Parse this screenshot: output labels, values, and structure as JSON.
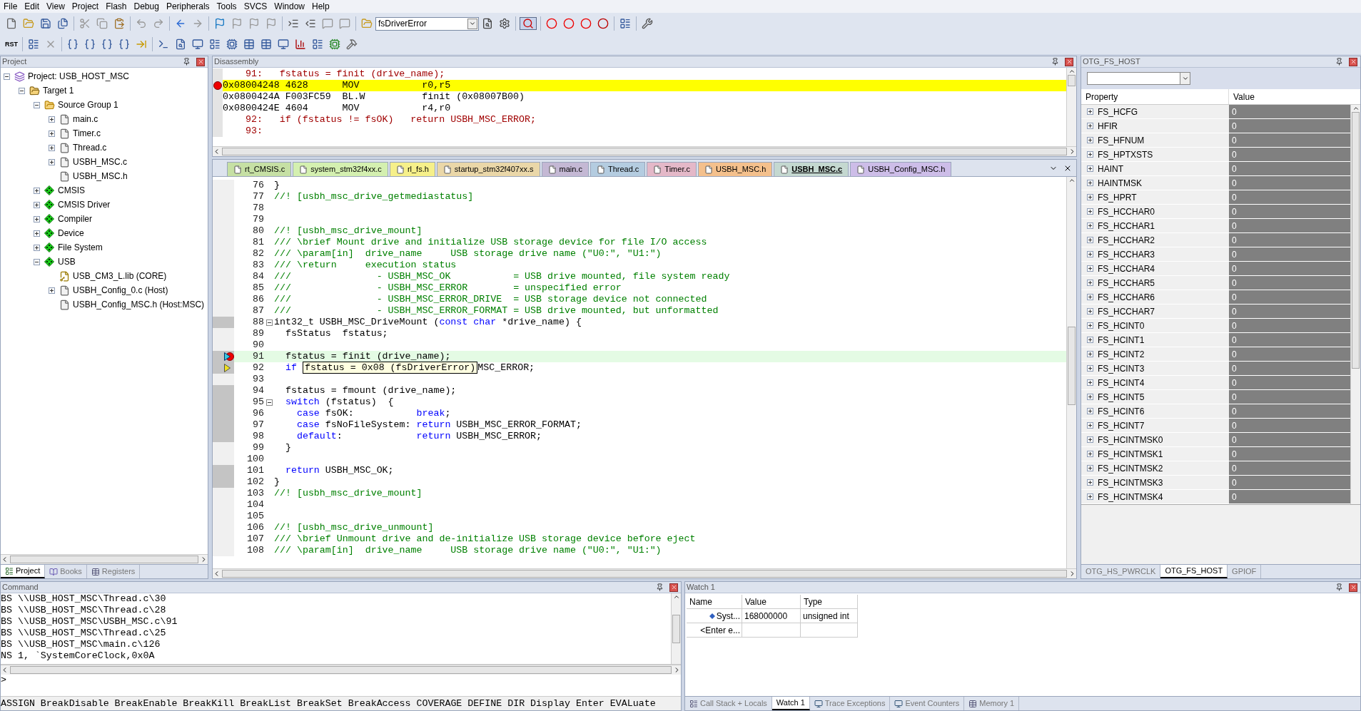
{
  "menu": [
    "File",
    "Edit",
    "View",
    "Project",
    "Flash",
    "Debug",
    "Peripherals",
    "Tools",
    "SVCS",
    "Window",
    "Help"
  ],
  "toolbar": {
    "find_value": "fsDriverError",
    "reset_label": "RST"
  },
  "project_panel": {
    "title": "Project",
    "tree": [
      {
        "label": "Project: USB_HOST_MSC",
        "kind": "project",
        "expanded": true,
        "children": [
          {
            "label": "Target 1",
            "kind": "target",
            "expanded": true,
            "children": [
              {
                "label": "Source Group 1",
                "kind": "folder",
                "expanded": true,
                "children": [
                  {
                    "label": "main.c",
                    "kind": "file",
                    "expanded": false
                  },
                  {
                    "label": "Timer.c",
                    "kind": "file",
                    "expanded": false
                  },
                  {
                    "label": "Thread.c",
                    "kind": "file",
                    "expanded": false
                  },
                  {
                    "label": "USBH_MSC.c",
                    "kind": "file",
                    "expanded": false
                  },
                  {
                    "label": "USBH_MSC.h",
                    "kind": "file"
                  }
                ]
              },
              {
                "label": "CMSIS",
                "kind": "component",
                "expanded": false
              },
              {
                "label": "CMSIS Driver",
                "kind": "component",
                "expanded": false
              },
              {
                "label": "Compiler",
                "kind": "component",
                "expanded": false
              },
              {
                "label": "Device",
                "kind": "component",
                "expanded": false
              },
              {
                "label": "File System",
                "kind": "component",
                "expanded": false
              },
              {
                "label": "USB",
                "kind": "component",
                "expanded": true,
                "children": [
                  {
                    "label": "USB_CM3_L.lib (CORE)",
                    "kind": "library"
                  },
                  {
                    "label": "USBH_Config_0.c (Host)",
                    "kind": "file",
                    "expanded": false
                  },
                  {
                    "label": "USBH_Config_MSC.h (Host:MSC)",
                    "kind": "file"
                  }
                ]
              }
            ]
          }
        ]
      }
    ],
    "tabs": [
      {
        "label": "Project",
        "selected": true
      },
      {
        "label": "Books",
        "selected": false
      },
      {
        "label": "Registers",
        "selected": false
      }
    ]
  },
  "disassembly": {
    "title": "Disassembly",
    "lines": [
      {
        "kind": "source",
        "text": "    91:   fstatus = finit (drive_name);",
        "current": false,
        "breakpoint": false
      },
      {
        "kind": "asm",
        "text": "0x08004248 4628      MOV           r0,r5",
        "current": true,
        "breakpoint": true
      },
      {
        "kind": "asm",
        "text": "0x0800424A F003FC59  BL.W          finit (0x08007B00)",
        "current": false,
        "breakpoint": false
      },
      {
        "kind": "asm",
        "text": "0x0800424E 4604      MOV           r4,r0",
        "current": false,
        "breakpoint": false
      },
      {
        "kind": "source",
        "text": "    92:   if (fstatus != fsOK)   return USBH_MSC_ERROR;",
        "current": false,
        "breakpoint": false
      },
      {
        "kind": "source",
        "text": "    93: ",
        "current": false,
        "breakpoint": false
      }
    ]
  },
  "file_tabs": [
    {
      "label": "rt_CMSIS.c",
      "color": "#c6e0a4",
      "selected": false
    },
    {
      "label": "system_stm32f4xx.c",
      "color": "#d4f0b0",
      "selected": false
    },
    {
      "label": "rl_fs.h",
      "color": "#f6f08a",
      "selected": false
    },
    {
      "label": "startup_stm32f407xx.s",
      "color": "#ead7a8",
      "selected": false
    },
    {
      "label": "main.c",
      "color": "#c4b8d4",
      "selected": false
    },
    {
      "label": "Thread.c",
      "color": "#b4cce0",
      "selected": false
    },
    {
      "label": "Timer.c",
      "color": "#e4b8c8",
      "selected": false
    },
    {
      "label": "USBH_MSC.h",
      "color": "#f4c08c",
      "selected": false
    },
    {
      "label": "USBH_MSC.c",
      "color": "#c4d8d0",
      "selected": true
    },
    {
      "label": "USBH_Config_MSC.h",
      "color": "#cdbde8",
      "selected": false
    }
  ],
  "editor": {
    "lines": [
      {
        "number": "76",
        "exec": false,
        "current": false,
        "foldable": false,
        "breakpoint": false,
        "pc": false,
        "caller": false,
        "segments": [
          {
            "kind": "plain",
            "text": "}"
          }
        ]
      },
      {
        "number": "77",
        "exec": false,
        "current": false,
        "foldable": false,
        "breakpoint": false,
        "pc": false,
        "caller": false,
        "segments": [
          {
            "kind": "comment",
            "text": "//! [usbh_msc_drive_getmediastatus]"
          }
        ]
      },
      {
        "number": "78",
        "exec": false,
        "current": false,
        "foldable": false,
        "breakpoint": false,
        "pc": false,
        "caller": false
      },
      {
        "number": "79",
        "exec": false,
        "current": false,
        "foldable": false,
        "breakpoint": false,
        "pc": false,
        "caller": false
      },
      {
        "number": "80",
        "exec": false,
        "current": false,
        "foldable": false,
        "breakpoint": false,
        "pc": false,
        "caller": false,
        "segments": [
          {
            "kind": "comment",
            "text": "//! [usbh_msc_drive_mount]"
          }
        ]
      },
      {
        "number": "81",
        "exec": false,
        "current": false,
        "foldable": false,
        "breakpoint": false,
        "pc": false,
        "caller": false,
        "segments": [
          {
            "kind": "comment",
            "text": "/// \\brief Mount drive and initialize USB storage device for file I/O access"
          }
        ]
      },
      {
        "number": "82",
        "exec": false,
        "current": false,
        "foldable": false,
        "breakpoint": false,
        "pc": false,
        "caller": false,
        "segments": [
          {
            "kind": "comment",
            "text": "/// \\param[in]  drive_name     USB storage drive name (\"U0:\", \"U1:\")"
          }
        ]
      },
      {
        "number": "83",
        "exec": false,
        "current": false,
        "foldable": false,
        "breakpoint": false,
        "pc": false,
        "caller": false,
        "segments": [
          {
            "kind": "comment",
            "text": "/// \\return     execution status"
          }
        ]
      },
      {
        "number": "84",
        "exec": false,
        "current": false,
        "foldable": false,
        "breakpoint": false,
        "pc": false,
        "caller": false,
        "segments": [
          {
            "kind": "comment",
            "text": "///               - USBH_MSC_OK           = USB drive mounted, file system ready"
          }
        ]
      },
      {
        "number": "85",
        "exec": false,
        "current": false,
        "foldable": false,
        "breakpoint": false,
        "pc": false,
        "caller": false,
        "segments": [
          {
            "kind": "comment",
            "text": "///               - USBH_MSC_ERROR        = unspecified error"
          }
        ]
      },
      {
        "number": "86",
        "exec": false,
        "current": false,
        "foldable": false,
        "breakpoint": false,
        "pc": false,
        "caller": false,
        "segments": [
          {
            "kind": "comment",
            "text": "///               - USBH_MSC_ERROR_DRIVE  = USB storage device not connected"
          }
        ]
      },
      {
        "number": "87",
        "exec": false,
        "current": false,
        "foldable": false,
        "breakpoint": false,
        "pc": false,
        "caller": false,
        "segments": [
          {
            "kind": "comment",
            "text": "///               - USBH_MSC_ERROR_FORMAT = USB drive mounted, but unformatted"
          }
        ]
      },
      {
        "number": "88",
        "exec": true,
        "current": false,
        "foldable": true,
        "breakpoint": false,
        "pc": false,
        "caller": false,
        "segments": [
          {
            "kind": "plain",
            "text": "int32_t USBH_MSC_DriveMount ("
          },
          {
            "kind": "keyword",
            "text": "const char"
          },
          {
            "kind": "plain",
            "text": " *drive_name) {"
          }
        ]
      },
      {
        "number": "89",
        "exec": false,
        "current": false,
        "foldable": false,
        "breakpoint": false,
        "pc": false,
        "caller": false,
        "segments": [
          {
            "kind": "plain",
            "text": "  fsStatus  fstatus;"
          }
        ]
      },
      {
        "number": "90",
        "exec": false,
        "current": false,
        "foldable": false,
        "breakpoint": false,
        "pc": false,
        "caller": false
      },
      {
        "number": "91",
        "exec": true,
        "current": true,
        "foldable": false,
        "breakpoint": true,
        "pc": true,
        "caller": false,
        "segments": [
          {
            "kind": "plain",
            "text": "  fstatus = finit (drive_name);"
          }
        ]
      },
      {
        "number": "92",
        "exec": true,
        "current": false,
        "foldable": false,
        "breakpoint": false,
        "pc": false,
        "caller": true,
        "segments": [
          {
            "kind": "keyword",
            "text": "  if "
          },
          {
            "kind": "tooltip",
            "text": "fstatus = 0x08 (fsDriverError)"
          },
          {
            "kind": "plain",
            "text": "MSC_ERROR;"
          }
        ]
      },
      {
        "number": "93",
        "exec": false,
        "current": false,
        "foldable": false,
        "breakpoint": false,
        "pc": false,
        "caller": false
      },
      {
        "number": "94",
        "exec": true,
        "current": false,
        "foldable": false,
        "breakpoint": false,
        "pc": false,
        "caller": false,
        "segments": [
          {
            "kind": "plain",
            "text": "  fstatus = fmount (drive_name);"
          }
        ]
      },
      {
        "number": "95",
        "exec": true,
        "current": false,
        "foldable": true,
        "breakpoint": false,
        "pc": false,
        "caller": false,
        "segments": [
          {
            "kind": "keyword",
            "text": "  switch"
          },
          {
            "kind": "plain",
            "text": " (fstatus)  {"
          }
        ]
      },
      {
        "number": "96",
        "exec": true,
        "current": false,
        "foldable": false,
        "breakpoint": false,
        "pc": false,
        "caller": false,
        "segments": [
          {
            "kind": "keyword",
            "text": "    case"
          },
          {
            "kind": "plain",
            "text": " fsOK:           "
          },
          {
            "kind": "keyword",
            "text": "break"
          },
          {
            "kind": "plain",
            "text": ";"
          }
        ]
      },
      {
        "number": "97",
        "exec": true,
        "current": false,
        "foldable": false,
        "breakpoint": false,
        "pc": false,
        "caller": false,
        "segments": [
          {
            "kind": "keyword",
            "text": "    case"
          },
          {
            "kind": "plain",
            "text": " fsNoFileSystem: "
          },
          {
            "kind": "keyword",
            "text": "return"
          },
          {
            "kind": "plain",
            "text": " USBH_MSC_ERROR_FORMAT;"
          }
        ]
      },
      {
        "number": "98",
        "exec": true,
        "current": false,
        "foldable": false,
        "breakpoint": false,
        "pc": false,
        "caller": false,
        "segments": [
          {
            "kind": "keyword",
            "text": "    default"
          },
          {
            "kind": "plain",
            "text": ":             "
          },
          {
            "kind": "keyword",
            "text": "return"
          },
          {
            "kind": "plain",
            "text": " USBH_MSC_ERROR;"
          }
        ]
      },
      {
        "number": "99",
        "exec": false,
        "current": false,
        "foldable": false,
        "breakpoint": false,
        "pc": false,
        "caller": false,
        "segments": [
          {
            "kind": "plain",
            "text": "  }"
          }
        ]
      },
      {
        "number": "100",
        "exec": false,
        "current": false,
        "foldable": false,
        "breakpoint": false,
        "pc": false,
        "caller": false
      },
      {
        "number": "101",
        "exec": true,
        "current": false,
        "foldable": false,
        "breakpoint": false,
        "pc": false,
        "caller": false,
        "segments": [
          {
            "kind": "keyword",
            "text": "  return"
          },
          {
            "kind": "plain",
            "text": " USBH_MSC_OK;"
          }
        ]
      },
      {
        "number": "102",
        "exec": true,
        "current": false,
        "foldable": false,
        "breakpoint": false,
        "pc": false,
        "caller": false,
        "segments": [
          {
            "kind": "plain",
            "text": "}"
          }
        ]
      },
      {
        "number": "103",
        "exec": false,
        "current": false,
        "foldable": false,
        "breakpoint": false,
        "pc": false,
        "caller": false,
        "segments": [
          {
            "kind": "comment",
            "text": "//! [usbh_msc_drive_mount]"
          }
        ]
      },
      {
        "number": "104",
        "exec": false,
        "current": false,
        "foldable": false,
        "breakpoint": false,
        "pc": false,
        "caller": false
      },
      {
        "number": "105",
        "exec": false,
        "current": false,
        "foldable": false,
        "breakpoint": false,
        "pc": false,
        "caller": false
      },
      {
        "number": "106",
        "exec": false,
        "current": false,
        "foldable": false,
        "breakpoint": false,
        "pc": false,
        "caller": false,
        "segments": [
          {
            "kind": "comment",
            "text": "//! [usbh_msc_drive_unmount]"
          }
        ]
      },
      {
        "number": "107",
        "exec": false,
        "current": false,
        "foldable": false,
        "breakpoint": false,
        "pc": false,
        "caller": false,
        "segments": [
          {
            "kind": "comment",
            "text": "/// \\brief Unmount drive and de-initialize USB storage device before eject"
          }
        ]
      },
      {
        "number": "108",
        "exec": false,
        "current": false,
        "foldable": false,
        "breakpoint": false,
        "pc": false,
        "caller": false,
        "segments": [
          {
            "kind": "comment",
            "text": "/// \\param[in]  drive_name     USB storage drive name (\"U0:\", \"U1:\")"
          }
        ]
      }
    ]
  },
  "peripheral_panel": {
    "title": "OTG_FS_HOST",
    "columns": [
      "Property",
      "Value"
    ],
    "rows": [
      {
        "name": "FS_HCFG",
        "value": "0"
      },
      {
        "name": "HFIR",
        "value": "0"
      },
      {
        "name": "FS_HFNUM",
        "value": "0"
      },
      {
        "name": "FS_HPTXSTS",
        "value": "0"
      },
      {
        "name": "HAINT",
        "value": "0"
      },
      {
        "name": "HAINTMSK",
        "value": "0"
      },
      {
        "name": "FS_HPRT",
        "value": "0"
      },
      {
        "name": "FS_HCCHAR0",
        "value": "0"
      },
      {
        "name": "FS_HCCHAR1",
        "value": "0"
      },
      {
        "name": "FS_HCCHAR2",
        "value": "0"
      },
      {
        "name": "FS_HCCHAR3",
        "value": "0"
      },
      {
        "name": "FS_HCCHAR4",
        "value": "0"
      },
      {
        "name": "FS_HCCHAR5",
        "value": "0"
      },
      {
        "name": "FS_HCCHAR6",
        "value": "0"
      },
      {
        "name": "FS_HCCHAR7",
        "value": "0"
      },
      {
        "name": "FS_HCINT0",
        "value": "0"
      },
      {
        "name": "FS_HCINT1",
        "value": "0"
      },
      {
        "name": "FS_HCINT2",
        "value": "0"
      },
      {
        "name": "FS_HCINT3",
        "value": "0"
      },
      {
        "name": "FS_HCINT4",
        "value": "0"
      },
      {
        "name": "FS_HCINT5",
        "value": "0"
      },
      {
        "name": "FS_HCINT6",
        "value": "0"
      },
      {
        "name": "FS_HCINT7",
        "value": "0"
      },
      {
        "name": "FS_HCINTMSK0",
        "value": "0"
      },
      {
        "name": "FS_HCINTMSK1",
        "value": "0"
      },
      {
        "name": "FS_HCINTMSK2",
        "value": "0"
      },
      {
        "name": "FS_HCINTMSK3",
        "value": "0"
      },
      {
        "name": "FS_HCINTMSK4",
        "value": "0"
      }
    ],
    "tabs": [
      {
        "label": "OTG_HS_PWRCLK",
        "selected": false
      },
      {
        "label": "OTG_FS_HOST",
        "selected": true
      },
      {
        "label": "GPIOF",
        "selected": false
      }
    ]
  },
  "command": {
    "title": "Command",
    "output": [
      "BS \\\\USB_HOST_MSC\\Thread.c\\30",
      "BS \\\\USB_HOST_MSC\\Thread.c\\28",
      "BS \\\\USB_HOST_MSC\\USBH_MSC.c\\91",
      "BS \\\\USB_HOST_MSC\\Thread.c\\25",
      "BS \\\\USB_HOST_MSC\\main.c\\126",
      "NS 1, `SystemCoreClock,0x0A"
    ],
    "prompt": ">",
    "help": "ASSIGN BreakDisable BreakEnable BreakKill BreakList BreakSet BreakAccess COVERAGE DEFINE DIR Display Enter EVALuate"
  },
  "watch": {
    "title": "Watch 1",
    "columns": [
      "Name",
      "Value",
      "Type"
    ],
    "rows": [
      {
        "name": "Syst...",
        "value": "168000000",
        "type": "unsigned int"
      },
      {
        "name": "<Enter e..."
      }
    ],
    "tabs": [
      {
        "label": "Call Stack + Locals",
        "selected": false
      },
      {
        "label": "Watch 1",
        "selected": true
      },
      {
        "label": "Trace Exceptions",
        "selected": false
      },
      {
        "label": "Event Counters",
        "selected": false
      },
      {
        "label": "Memory 1",
        "selected": false
      }
    ]
  }
}
